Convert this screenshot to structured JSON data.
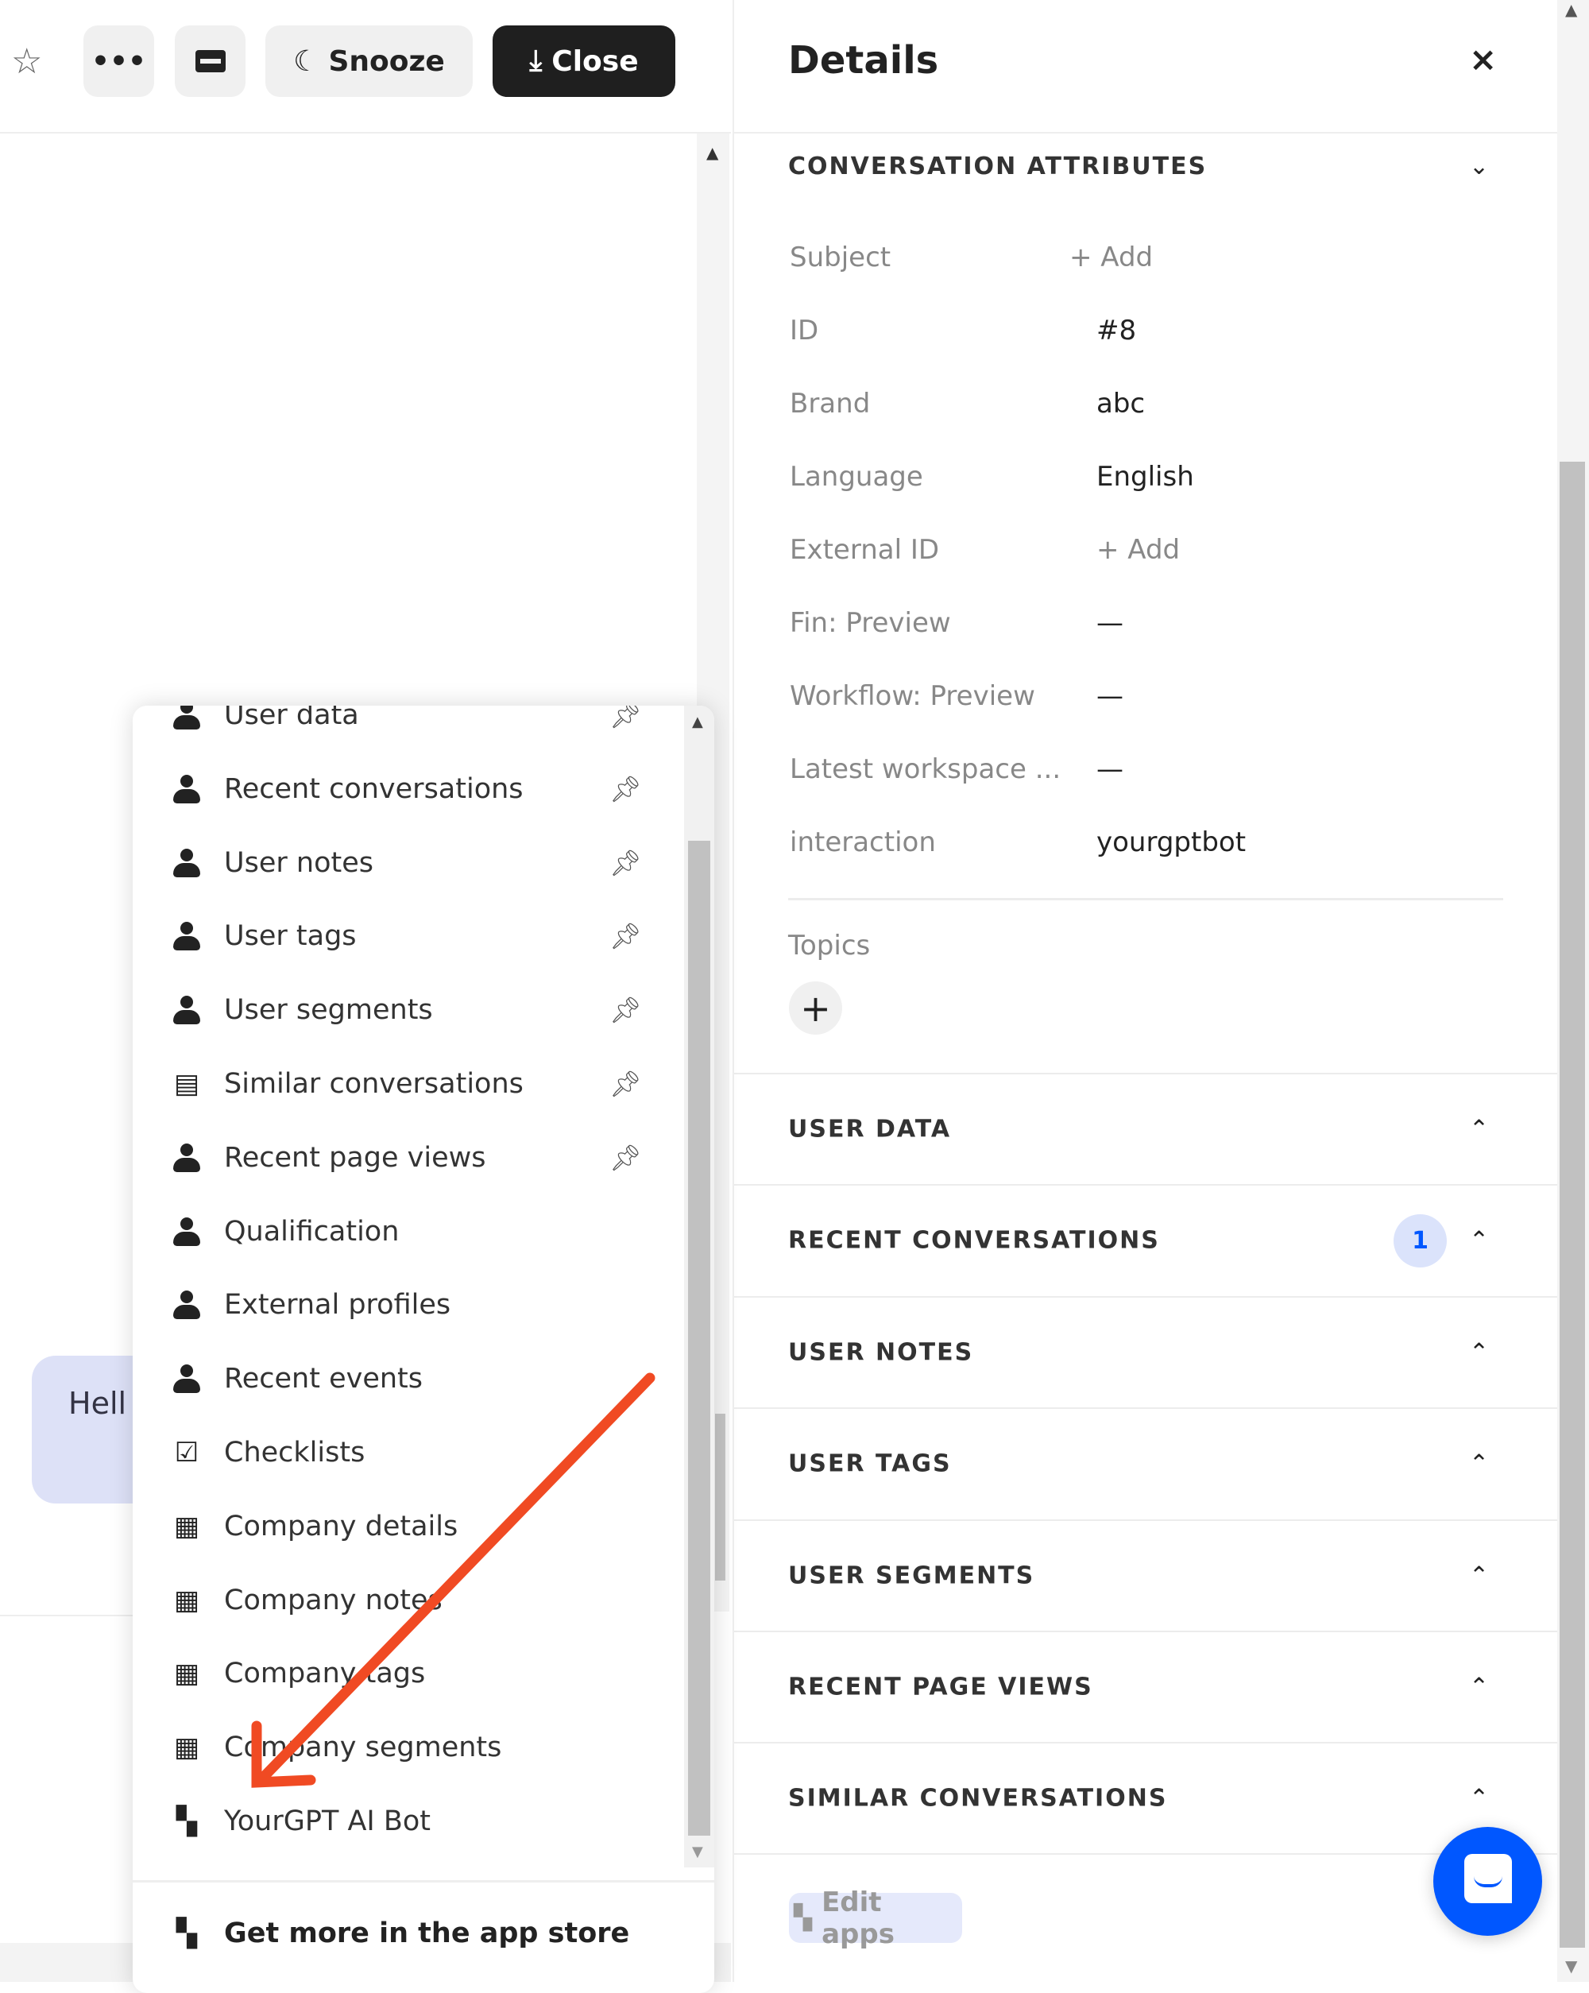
{
  "toolbar": {
    "star_icon": "star-icon",
    "more_label": "•••",
    "ticket_icon": "ticket-icon",
    "snooze_label": "Snooze",
    "close_label": "Close"
  },
  "conversation": {
    "message_preview": "Hell"
  },
  "details": {
    "title": "Details",
    "close_label": "×",
    "attributes_title": "CONVERSATION ATTRIBUTES",
    "attributes": [
      {
        "label": "Subject",
        "value": "+ Add"
      },
      {
        "label": "ID",
        "value": "#8"
      },
      {
        "label": "Brand",
        "value": "abc"
      },
      {
        "label": "Language",
        "value": "English"
      },
      {
        "label": "External ID",
        "value": "+ Add"
      },
      {
        "label": "Fin: Preview",
        "value": "—"
      },
      {
        "label": "Workflow: Preview",
        "value": "—"
      },
      {
        "label": "Latest workspace ...",
        "value": "—"
      },
      {
        "label": "interaction",
        "value": "yourgptbot"
      }
    ],
    "topics_label": "Topics",
    "topics_add": "+",
    "sections": [
      {
        "title": "USER DATA"
      },
      {
        "title": "RECENT CONVERSATIONS",
        "badge": "1"
      },
      {
        "title": "USER NOTES"
      },
      {
        "title": "USER TAGS"
      },
      {
        "title": "USER SEGMENTS"
      },
      {
        "title": "RECENT PAGE VIEWS"
      },
      {
        "title": "SIMILAR CONVERSATIONS"
      }
    ],
    "edit_apps_label": "Edit apps",
    "badge_color": "#dbe3fb",
    "accent": "#0057ff"
  },
  "apps_menu": {
    "items": [
      {
        "label": "User data",
        "icon": "person-icon",
        "pinned": true
      },
      {
        "label": "Recent conversations",
        "icon": "person-icon",
        "pinned": true
      },
      {
        "label": "User notes",
        "icon": "person-icon",
        "pinned": true
      },
      {
        "label": "User tags",
        "icon": "person-icon",
        "pinned": true
      },
      {
        "label": "User segments",
        "icon": "person-icon",
        "pinned": true
      },
      {
        "label": "Similar conversations",
        "icon": "chat-icon",
        "pinned": true
      },
      {
        "label": "Recent page views",
        "icon": "person-icon",
        "pinned": true
      },
      {
        "label": "Qualification",
        "icon": "person-icon",
        "pinned": false
      },
      {
        "label": "External profiles",
        "icon": "person-icon",
        "pinned": false
      },
      {
        "label": "Recent events",
        "icon": "person-icon",
        "pinned": false
      },
      {
        "label": "Checklists",
        "icon": "checklist-icon",
        "pinned": false
      },
      {
        "label": "Company details",
        "icon": "building-icon",
        "pinned": false
      },
      {
        "label": "Company notes",
        "icon": "building-icon",
        "pinned": false
      },
      {
        "label": "Company tags",
        "icon": "building-icon",
        "pinned": false
      },
      {
        "label": "Company segments",
        "icon": "building-icon",
        "pinned": false
      },
      {
        "label": "YourGPT AI Bot",
        "icon": "apps-icon",
        "pinned": false
      }
    ],
    "footer_label": "Get more in the app store"
  },
  "annotation_color": "#f04a23"
}
